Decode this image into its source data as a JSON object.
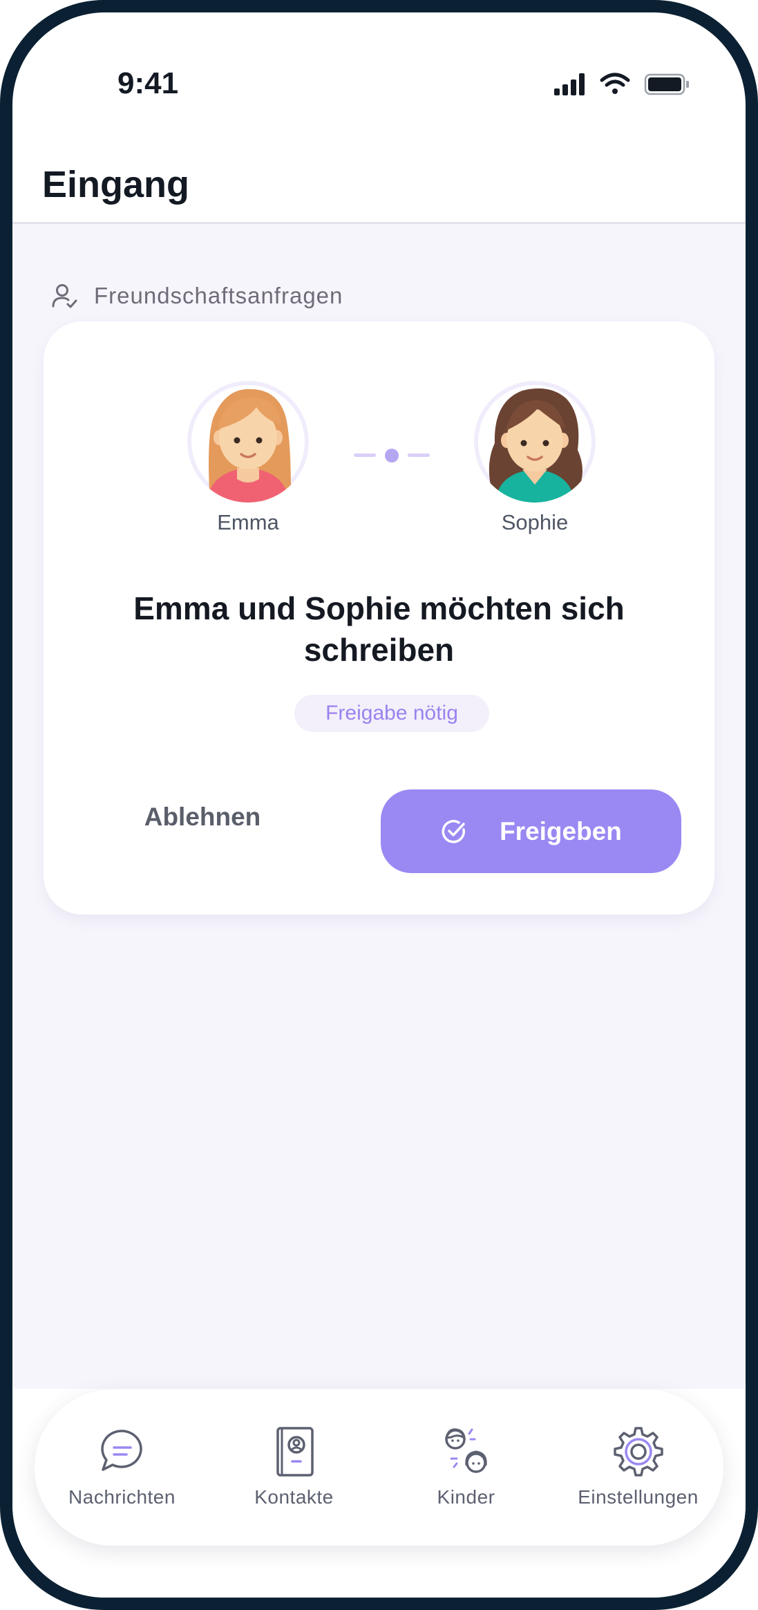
{
  "status_bar": {
    "time": "9:41"
  },
  "header": {
    "title": "Eingang"
  },
  "section": {
    "label": "Freundschaftsanfragen",
    "icon": "user-check-icon"
  },
  "request": {
    "child_a": {
      "name": "Emma"
    },
    "child_b": {
      "name": "Sophie"
    },
    "title": "Emma und Sophie möchten sich schreiben",
    "badge": "Freigabe nötig",
    "decline_label": "Ablehnen",
    "approve_label": "Freigeben"
  },
  "tabbar": {
    "items": [
      {
        "label": "Nachrichten",
        "icon": "chat-bubble-icon"
      },
      {
        "label": "Kontakte",
        "icon": "contact-book-icon"
      },
      {
        "label": "Kinder",
        "icon": "children-icon"
      },
      {
        "label": "Einstellungen",
        "icon": "gear-icon"
      }
    ]
  },
  "colors": {
    "accent": "#9a88f3",
    "badge_text": "#9b82ef",
    "background": "#f7f5fc",
    "frame": "#0b2133"
  }
}
